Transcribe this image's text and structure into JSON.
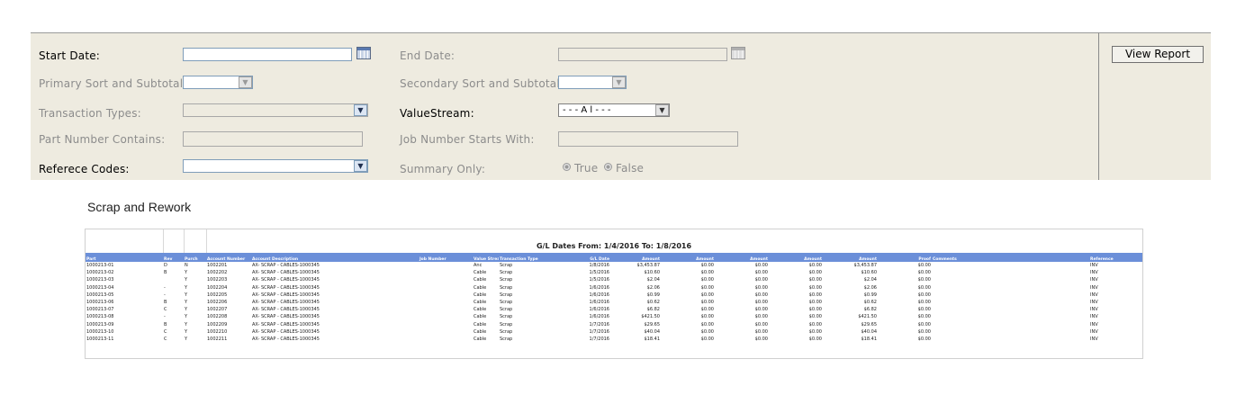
{
  "filters": {
    "start_date": {
      "label": "Start Date:",
      "value": ""
    },
    "end_date": {
      "label": "End Date:",
      "value": ""
    },
    "primary_sort": {
      "label": "Primary Sort and Subtotal:",
      "value": ""
    },
    "secondary_sort": {
      "label": "Secondary Sort and Subtotal:",
      "value": ""
    },
    "transaction_types": {
      "label": "Transaction Types:",
      "value": ""
    },
    "value_stream": {
      "label": "ValueStream:",
      "value": "- - - A l - - -"
    },
    "part_number": {
      "label": "Part Number Contains:",
      "value": ""
    },
    "job_number": {
      "label": "Job Number Starts With:",
      "value": ""
    },
    "reference_codes": {
      "label": "Referece Codes:",
      "value": ""
    },
    "summary_only": {
      "label": "Summary Only:",
      "options": [
        "True",
        "False"
      ]
    }
  },
  "view_report_label": "View Report",
  "report": {
    "title": "Scrap and Rework",
    "gl_dates": "G/L Dates From: 1/4/2016 To: 1/8/2016",
    "columns": [
      "Part",
      "Rev",
      "Purch",
      "Account Number",
      "Account Description",
      "Job Number",
      "Value Stream",
      "Transaction Type",
      "G/L Date",
      "Amount",
      "Amount",
      "Amount",
      "Amount",
      "Amount",
      "Proof",
      "Comments",
      "Reference"
    ],
    "rows": [
      [
        "1000213-01",
        "D",
        "N",
        "1002201",
        "AX- SCRAP - CABLES-1000345",
        "",
        "Anc",
        "Scrap",
        "1/8/2016",
        "$3,453.87",
        "$0.00",
        "$0.00",
        "$0.00",
        "$3,453.87",
        "$0.00",
        "",
        "INV"
      ],
      [
        "1000213-02",
        "B",
        "Y",
        "1002202",
        "AX- SCRAP - CABLES-1000345",
        "",
        "Cable",
        "Scrap",
        "1/5/2016",
        "$10.60",
        "$0.00",
        "$0.00",
        "$0.00",
        "$10.60",
        "$0.00",
        "",
        "INV"
      ],
      [
        "1000213-03",
        "",
        "Y",
        "1002203",
        "AX- SCRAP - CABLES-1000345",
        "",
        "Cable",
        "Scrap",
        "1/5/2016",
        "$2.04",
        "$0.00",
        "$0.00",
        "$0.00",
        "$2.04",
        "$0.00",
        "",
        "INV"
      ],
      [
        "1000213-04",
        "-",
        "Y",
        "1002204",
        "AX- SCRAP - CABLES-1000345",
        "",
        "Cable",
        "Scrap",
        "1/6/2016",
        "$2.06",
        "$0.00",
        "$0.00",
        "$0.00",
        "$2.06",
        "$0.00",
        "",
        "INV"
      ],
      [
        "1000213-05",
        "-",
        "Y",
        "1002205",
        "AX- SCRAP - CABLES-1000345",
        "",
        "Cable",
        "Scrap",
        "1/6/2016",
        "$0.99",
        "$0.00",
        "$0.00",
        "$0.00",
        "$0.99",
        "$0.00",
        "",
        "INV"
      ],
      [
        "1000213-06",
        "B",
        "Y",
        "1002206",
        "AX- SCRAP - CABLES-1000345",
        "",
        "Cable",
        "Scrap",
        "1/6/2016",
        "$0.62",
        "$0.00",
        "$0.00",
        "$0.00",
        "$0.62",
        "$0.00",
        "",
        "INV"
      ],
      [
        "1000213-07",
        "C",
        "Y",
        "1002207",
        "AX- SCRAP - CABLES-1000345",
        "",
        "Cable",
        "Scrap",
        "1/6/2016",
        "$6.82",
        "$0.00",
        "$0.00",
        "$0.00",
        "$6.82",
        "$0.00",
        "",
        "INV"
      ],
      [
        "1000213-08",
        "-",
        "Y",
        "1002208",
        "AX- SCRAP - CABLES-1000345",
        "",
        "Cable",
        "Scrap",
        "1/6/2016",
        "$421.50",
        "$0.00",
        "$0.00",
        "$0.00",
        "$421.50",
        "$0.00",
        "",
        "INV"
      ],
      [
        "1000213-09",
        "B",
        "Y",
        "1002209",
        "AX- SCRAP - CABLES-1000345",
        "",
        "Cable",
        "Scrap",
        "1/7/2016",
        "$29.65",
        "$0.00",
        "$0.00",
        "$0.00",
        "$29.65",
        "$0.00",
        "",
        "INV"
      ],
      [
        "1000213-10",
        "C",
        "Y",
        "1002210",
        "AX- SCRAP - CABLES-1000345",
        "",
        "Cable",
        "Scrap",
        "1/7/2016",
        "$40.04",
        "$0.00",
        "$0.00",
        "$0.00",
        "$40.04",
        "$0.00",
        "",
        "INV"
      ],
      [
        "1000213-11",
        "C",
        "Y",
        "1002211",
        "AX- SCRAP - CABLES-1000345",
        "",
        "Cable",
        "Scrap",
        "1/7/2016",
        "$18.41",
        "$0.00",
        "$0.00",
        "$0.00",
        "$18.41",
        "$0.00",
        "",
        "INV"
      ]
    ]
  },
  "colors": {
    "panel_bg": "#eeebe0",
    "header_blue": "#6b8fd9",
    "field_border": "#7f9db9"
  },
  "icons": {
    "calendar": "calendar-icon",
    "dropdown": "chevron-down-icon"
  }
}
